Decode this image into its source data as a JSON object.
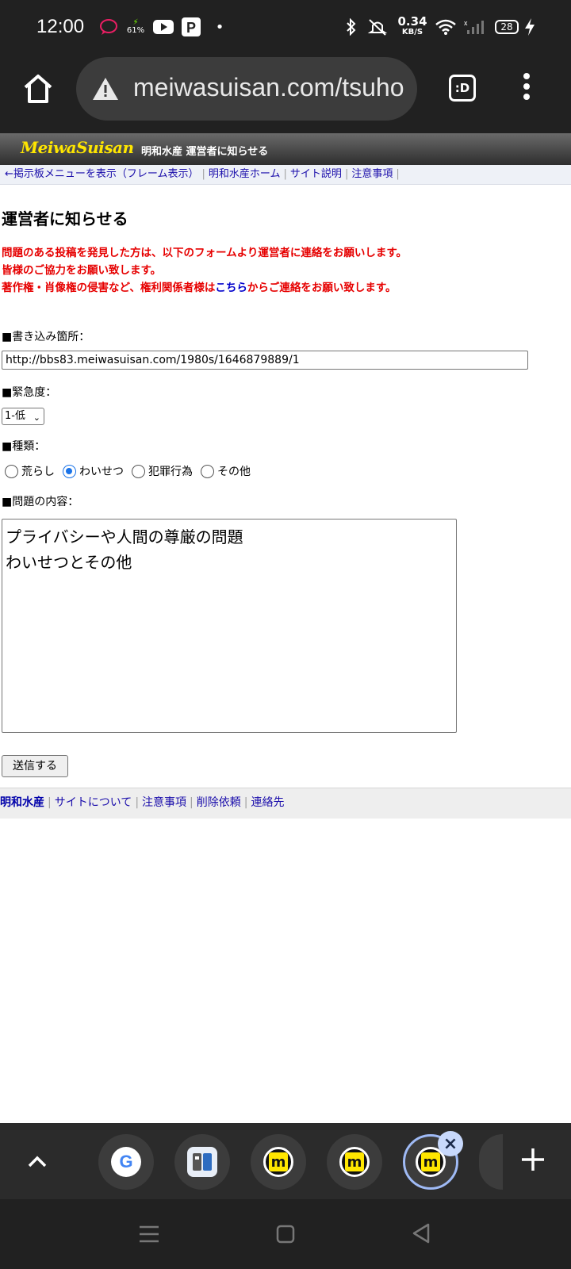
{
  "status_bar": {
    "time": "12:00",
    "battery_cell": "61%",
    "network_speed_value": "0.34",
    "network_speed_unit": "KB/S",
    "battery_level": "28",
    "icons": [
      "sms-icon",
      "battery-saver-icon",
      "youtube-icon",
      "paypay-icon",
      "dot-icon",
      "bluetooth-icon",
      "mute-icon",
      "wifi-icon",
      "cell-signal-icon",
      "charging-icon"
    ]
  },
  "browser": {
    "url": "meiwasuisan.com/tsuho",
    "tabs_label": ":D"
  },
  "site": {
    "logo": "MeiwaSuisan",
    "header_title": "明和水産 運営者に知らせる",
    "nav": [
      "←掲示板メニューを表示（フレーム表示）",
      "明和水産ホーム",
      "サイト説明",
      "注意事項"
    ]
  },
  "page": {
    "heading": "運営者に知らせる",
    "notice_line1": "問題のある投稿を発見した方は、以下のフォームより運営者に連絡をお願いします。",
    "notice_line2": "皆様のご協力をお願い致します。",
    "notice_line3_pre": "著作権・肖像権の侵害など、権利関係者様は",
    "notice_line3_link": "こちら",
    "notice_line3_post": "からご連絡をお願い致します。",
    "location_label": "■書き込み箇所：",
    "location_value": "http://bbs83.meiwasuisan.com/1980s/1646879889/1",
    "urgency_label": "■緊急度：",
    "urgency_value": "1-低",
    "type_label": "■種類：",
    "type_options": [
      "荒らし",
      "わいせつ",
      "犯罪行為",
      "その他"
    ],
    "type_selected": "わいせつ",
    "content_label": "■問題の内容：",
    "content_value": "プライバシーや人間の尊厳の問題\nわいせつとその他",
    "submit_label": "送信する"
  },
  "footer": {
    "links": [
      "明和水産",
      "サイトについて",
      "注意事項",
      "削除依頼",
      "連絡先"
    ]
  },
  "tab_strip": {
    "tabs": [
      "google-favicon",
      "app-favicon",
      "meiwasuisan-favicon",
      "meiwasuisan-favicon",
      "meiwasuisan-favicon-active"
    ],
    "favicon_letter": "m",
    "google_letter": "G"
  },
  "colors": {
    "notice_red": "#e60000",
    "link_blue": "#1a0dab",
    "logo_yellow": "#ffe600"
  }
}
